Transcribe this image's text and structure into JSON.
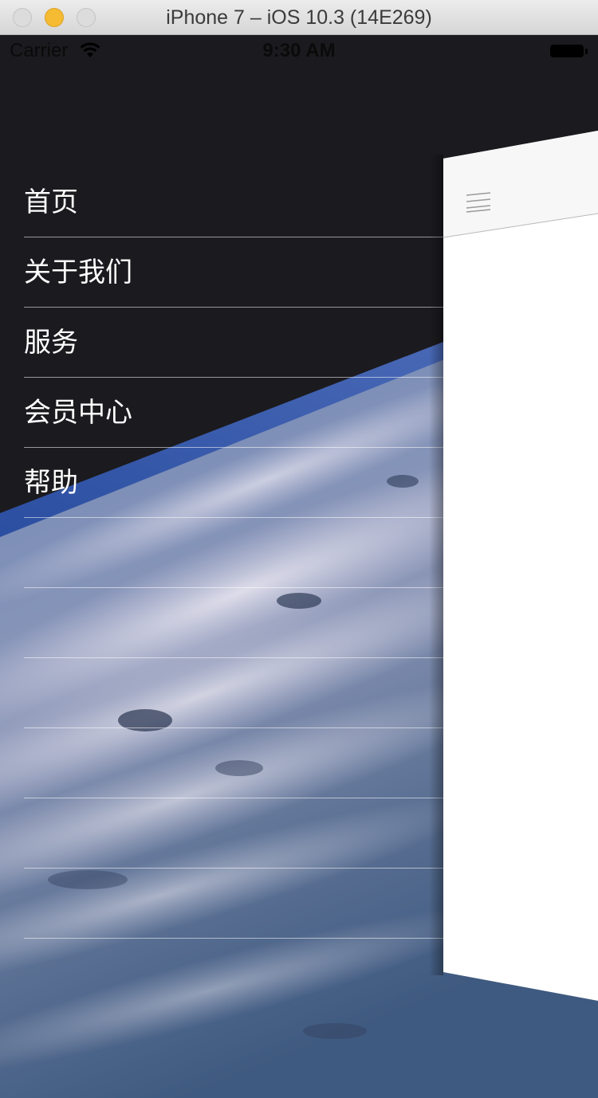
{
  "window": {
    "title": "iPhone 7 – iOS 10.3 (14E269)",
    "controls": [
      "close",
      "minimize",
      "zoom"
    ]
  },
  "status_bar": {
    "carrier": "Carrier",
    "time": "9:30 AM",
    "icons": [
      "wifi-icon",
      "battery-icon"
    ]
  },
  "menu": {
    "items": [
      {
        "label": "首页"
      },
      {
        "label": "关于我们"
      },
      {
        "label": "服务"
      },
      {
        "label": "会员中心"
      },
      {
        "label": "帮助"
      },
      {
        "label": ""
      },
      {
        "label": ""
      },
      {
        "label": ""
      },
      {
        "label": ""
      },
      {
        "label": ""
      },
      {
        "label": ""
      }
    ]
  },
  "content_panel": {
    "nav_icon": "hamburger-menu-icon"
  },
  "colors": {
    "menu_text": "#ffffff",
    "background": "#1b1a1e",
    "panel_nav": "#f7f7f7",
    "panel_body": "#ffffff"
  }
}
